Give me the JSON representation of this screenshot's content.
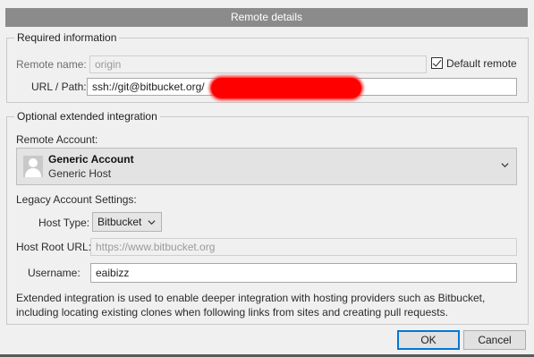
{
  "dialog": {
    "title": "Remote details"
  },
  "required": {
    "legend": "Required information",
    "remote_name_label": "Remote name:",
    "remote_name_value": "origin",
    "default_remote_label": "Default remote",
    "default_remote_checked": true,
    "url_label": "URL / Path:",
    "url_value": "ssh://git@bitbucket.org/"
  },
  "optional": {
    "legend": "Optional extended integration",
    "remote_account_label": "Remote Account:",
    "account": {
      "name": "Generic Account",
      "host": "Generic Host",
      "icon": "user-avatar-icon"
    },
    "legacy_label": "Legacy Account Settings:",
    "host_type_label": "Host Type:",
    "host_type_value": "Bitbucket",
    "host_root_label": "Host Root URL:",
    "host_root_placeholder": "https://www.bitbucket.org",
    "username_label": "Username:",
    "username_value": "eaibizz",
    "note": "Extended integration is used to enable deeper integration with hosting providers such as Bitbucket, including locating existing clones when following links from sites and creating pull requests."
  },
  "buttons": {
    "ok": "OK",
    "cancel": "Cancel"
  },
  "colors": {
    "titlebar": "#8b8b8b",
    "redaction": "#ff0000",
    "default_button_border": "#0078d7"
  }
}
